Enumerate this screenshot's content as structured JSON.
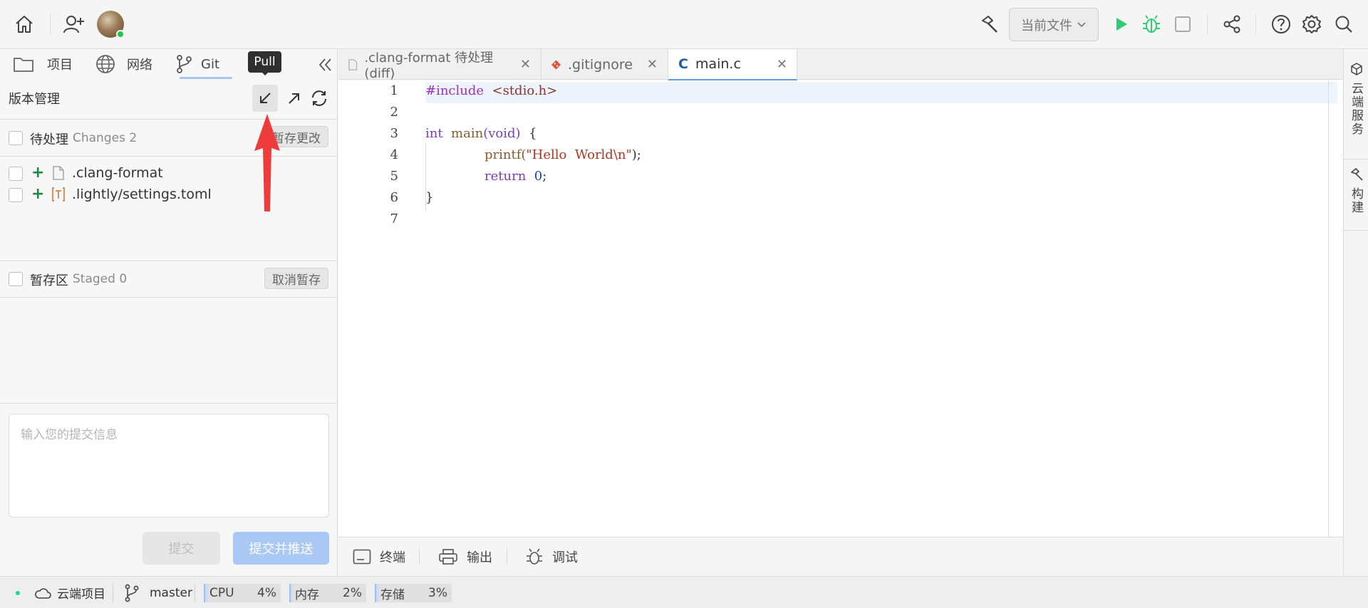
{
  "topbar": {
    "target_select": "当前文件"
  },
  "sidebar": {
    "tabs": [
      {
        "label": "项目",
        "icon": "folder-icon"
      },
      {
        "label": "网络",
        "icon": "globe-icon"
      },
      {
        "label": "Git",
        "icon": "git-branch-icon",
        "active": true
      }
    ],
    "title": "版本管理",
    "tooltip": "Pull",
    "pending": {
      "label": "待处理",
      "sub": "Changes 2",
      "button": "暂存更改",
      "files": [
        {
          "name": ".clang-format",
          "icon": "file-icon"
        },
        {
          "name": ".lightly/settings.toml",
          "icon": "toml-file-icon"
        }
      ]
    },
    "staged": {
      "label": "暂存区",
      "sub": "Staged 0",
      "button": "取消暂存"
    },
    "commit_placeholder": "输入您的提交信息",
    "commit_button": "提交",
    "commit_push_button": "提交并推送"
  },
  "editor": {
    "tabs": [
      {
        "label": ".clang-format 待处理(diff)",
        "icon": "file-icon"
      },
      {
        "label": ".gitignore",
        "icon": "git-file-icon"
      },
      {
        "label": "main.c",
        "icon": "c-language-icon",
        "active": true
      }
    ],
    "line_numbers": [
      "1",
      "2",
      "3",
      "4",
      "5",
      "6",
      "7"
    ],
    "code": {
      "l1_directive": "#include",
      "l1_header": "<stdio.h>",
      "l3_type": "int",
      "l3_name": "main",
      "l3_param": "(void)",
      "l3_brace": "{",
      "l4_func": "printf(",
      "l4_string": "\"Hello  World\\n\"",
      "l4_end": ");",
      "l5_return": "return",
      "l5_value": "0",
      "l5_end": ";",
      "l6_brace": "}"
    }
  },
  "right_rail": {
    "cloud": "云端服务",
    "build": "构建"
  },
  "panel": {
    "tabs": [
      "终端",
      "输出",
      "调试"
    ]
  },
  "status": {
    "cloud_project": "云端项目",
    "branch": "master",
    "meters": [
      {
        "label": "CPU",
        "value": "4%",
        "fraction": 0.04
      },
      {
        "label": "内存",
        "value": "2%",
        "fraction": 0.02
      },
      {
        "label": "存储",
        "value": "3%",
        "fraction": 0.03
      }
    ]
  },
  "colors": {
    "accent": "#5b9bec",
    "run_green": "#2ecc71",
    "arrow_red": "#ee3b3b",
    "commit_push_bg": "#a9c8f3"
  }
}
